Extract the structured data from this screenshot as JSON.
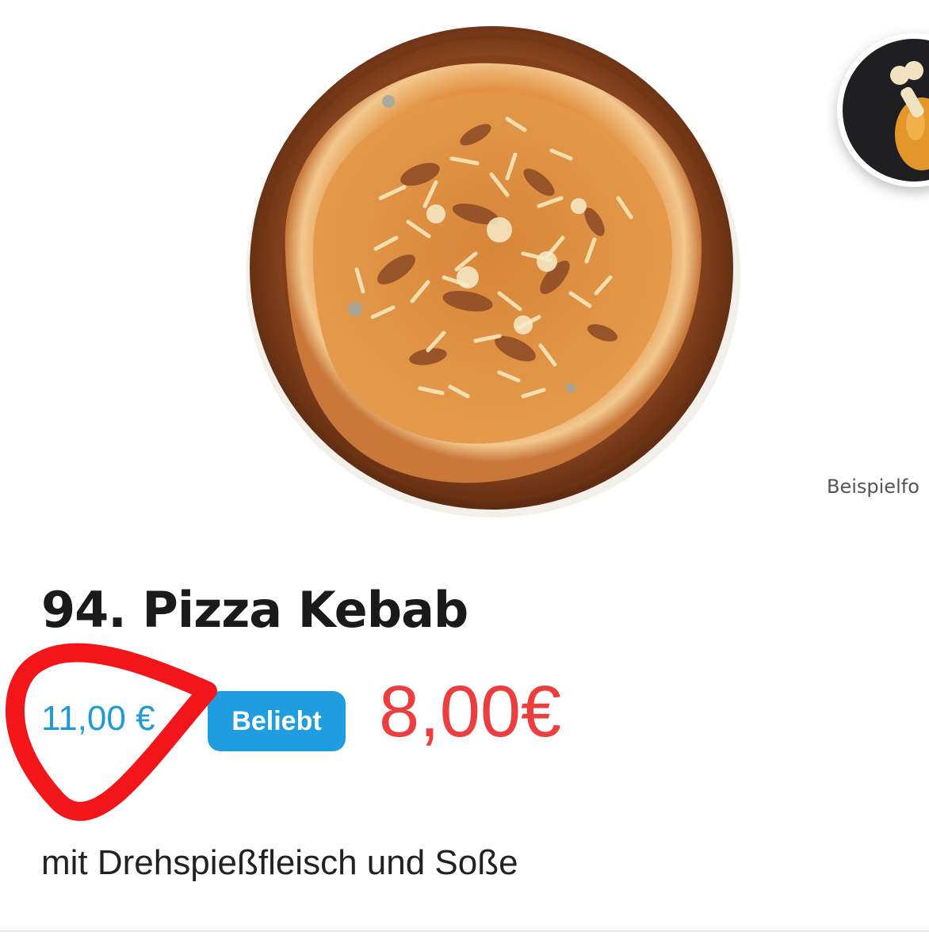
{
  "product": {
    "title": "94. Pizza Kebab",
    "old_price": "11,00 €",
    "popular_badge": "Beliebt",
    "price": "8,00€",
    "description": "mit Drehspießfleisch und Soße",
    "image_caption": "Beispielfo"
  },
  "icons": {
    "category_badge": "chicken-leg-icon",
    "annotation": "red-circle-annotation"
  },
  "colors": {
    "price_red": "#ec3d3f",
    "accent_blue": "#1e9ee0",
    "annotation_red": "#f2161b"
  }
}
